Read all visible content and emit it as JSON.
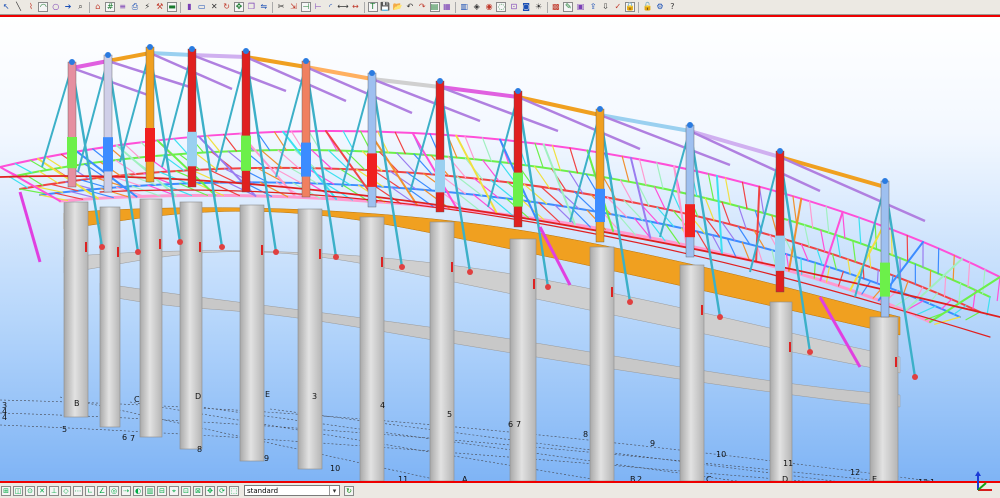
{
  "toolbar": {
    "icons": [
      "select-icon",
      "line-icon",
      "polyline-icon",
      "arc-icon",
      "circle-icon",
      "arrow-right-icon",
      "zoom-icon",
      "home-icon",
      "grid-icon",
      "layers-icon",
      "print-icon",
      "bolt-icon",
      "weld-icon",
      "beam-icon",
      "column-icon",
      "plate-icon",
      "bracing-icon",
      "rotate-icon",
      "move-icon",
      "copy-icon",
      "mirror-icon",
      "cut-icon",
      "stretch-icon",
      "trim-icon",
      "extend-icon",
      "fillet-icon",
      "measure-icon",
      "dimension-icon",
      "text-icon",
      "save-icon",
      "open-icon",
      "undo-icon",
      "redo-icon",
      "view-front-icon",
      "view-top-icon",
      "view-side-icon",
      "view-3d-icon",
      "render-icon",
      "hide-icon",
      "clip-icon",
      "camera-icon",
      "light-icon",
      "material-icon",
      "paint-icon",
      "report-icon",
      "export-icon",
      "import-icon",
      "check-icon",
      "lock-icon",
      "unlock-icon",
      "settings-icon",
      "help-icon"
    ]
  },
  "grid_labels": {
    "back_letters": [
      {
        "text": "B"
      },
      {
        "text": "C"
      },
      {
        "text": "D"
      },
      {
        "text": "E"
      }
    ],
    "back_numbers": [
      {
        "text": "3"
      },
      {
        "text": "4"
      },
      {
        "text": "5"
      },
      {
        "text": "6"
      },
      {
        "text": "7"
      }
    ],
    "left_numbers": [
      {
        "text": "3"
      },
      {
        "text": "4"
      },
      {
        "text": "4"
      },
      {
        "text": "5"
      },
      {
        "text": "6"
      },
      {
        "text": "7"
      },
      {
        "text": "8"
      },
      {
        "text": "9"
      },
      {
        "text": "10"
      },
      {
        "text": "11"
      }
    ],
    "front_numbers": [
      {
        "text": "8"
      },
      {
        "text": "9"
      },
      {
        "text": "10"
      },
      {
        "text": "11"
      },
      {
        "text": "12"
      },
      {
        "text": "12"
      },
      {
        "text": "1"
      }
    ],
    "front_letters": [
      {
        "text": "A"
      },
      {
        "text": "B"
      },
      {
        "text": "2"
      },
      {
        "text": "C"
      },
      {
        "text": "D"
      },
      {
        "text": "E"
      }
    ]
  },
  "statusbar": {
    "view_combo": "standard",
    "icons": [
      "snap-end-icon",
      "snap-mid-icon",
      "snap-center-icon",
      "snap-intersect-icon",
      "snap-perp-icon",
      "snap-near-icon",
      "snap-grid-icon",
      "ortho-icon",
      "polar-icon",
      "object-snap-icon",
      "track-icon",
      "dyn-icon",
      "weight-icon",
      "select-filter-icon",
      "pick-icon",
      "zoom-window-icon",
      "zoom-all-icon",
      "pan-icon",
      "orbit-icon",
      "refresh-icon"
    ]
  },
  "colors": {
    "selection_border": "#ee0000",
    "sky_top": "#ffffff",
    "sky_bottom": "#7fb4f5",
    "concrete": "#d3d3d3",
    "eave_beam": "#f0a020"
  }
}
